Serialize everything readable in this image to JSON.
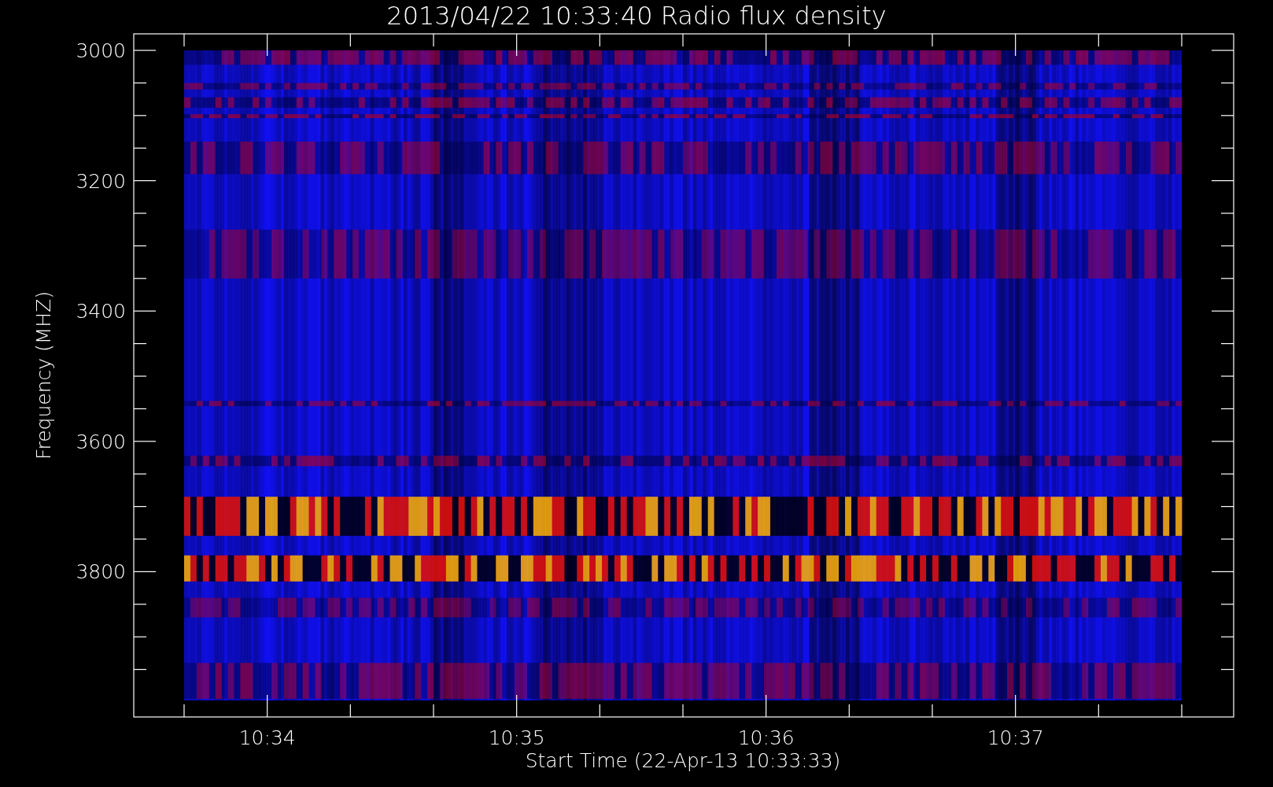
{
  "title": "2013/04/22 10:33:40 Radio flux density",
  "y_axis": {
    "label": "Frequency (MHZ)",
    "ticks": [
      "3000",
      "3200",
      "3400",
      "3600",
      "3800"
    ]
  },
  "x_axis": {
    "label": "Start Time (22-Apr-13 10:33:33)",
    "ticks": [
      "10:34",
      "10:35",
      "10:36",
      "10:37"
    ]
  }
}
